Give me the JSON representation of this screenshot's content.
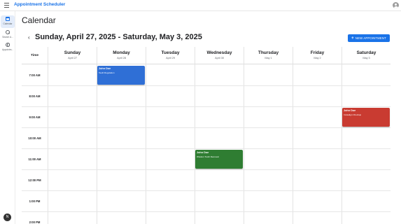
{
  "app": {
    "title": "Appointment Scheduler"
  },
  "colors": {
    "primary": "#1a73e8",
    "blue_event": "#2f6fd6",
    "red_event": "#c93b31",
    "green_event": "#2f7d32"
  },
  "icons": {
    "menu": "hamburger-menu-icon",
    "account": "account-circle-icon",
    "calendar": "calendar-icon",
    "search": "search-icon",
    "appointments": "globe-icon"
  },
  "rail": {
    "items": [
      {
        "label": "Calendar",
        "active": true
      },
      {
        "label": "Search A...",
        "active": false
      },
      {
        "label": "Appointm...",
        "active": false
      }
    ],
    "user_initial": "N"
  },
  "main": {
    "title": "Calendar",
    "week_range": "Sunday, April 27, 2025 - Saturday, May 3, 2025",
    "prev_symbol": "‹",
    "next_symbol": "›",
    "new_button": "NEW APPOINTMENT",
    "new_button_icon": "+"
  },
  "calendar": {
    "time_header": "Time",
    "days": [
      {
        "name": "Sunday",
        "date": "April 27"
      },
      {
        "name": "Monday",
        "date": "April 28"
      },
      {
        "name": "Tuesday",
        "date": "April 29"
      },
      {
        "name": "Wednesday",
        "date": "April 30"
      },
      {
        "name": "Thursday",
        "date": "May 1"
      },
      {
        "name": "Friday",
        "date": "May 2"
      },
      {
        "name": "Saturday",
        "date": "May 3"
      }
    ],
    "times": [
      "7:00 AM",
      "8:00 AM",
      "9:00 AM",
      "10:00 AM",
      "11:00 AM",
      "12:00 PM",
      "1:00 PM",
      "2:00 PM"
    ],
    "appointments": [
      {
        "name": "John Doe",
        "type": "Teeth Regulation",
        "day": "Monday",
        "start": "7:00 AM",
        "color": "#2f6fd6"
      },
      {
        "name": "John Doe",
        "type": "Wisdom Tooth Removal",
        "day": "Wednesday",
        "start": "11:00 AM",
        "color": "#2f7d32"
      },
      {
        "name": "John Doe",
        "type": "Invisalign Checkup",
        "day": "Saturday",
        "start": "9:00 AM",
        "color": "#c93b31"
      }
    ]
  }
}
